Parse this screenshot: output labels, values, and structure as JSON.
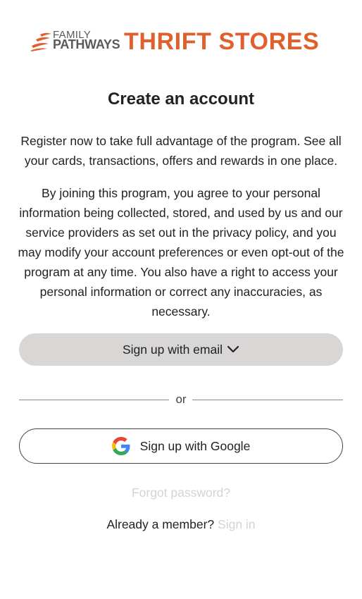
{
  "brand": {
    "family": "FAMILY",
    "pathways": "PATHWAYS",
    "stores": "THRIFT STORES",
    "accent_color": "#df5f2d"
  },
  "page": {
    "title": "Create an account",
    "intro": "Register now to take full advantage of the program. See all your cards, transactions, offers and rewards in one place.",
    "consent": "By joining this program, you agree to your personal information being collected, stored, and used by us and our service providers as set out in the privacy policy, and you may modify your account preferences or even opt-out of the program at any time. You also have a right to access your personal information or correct any inaccuracies, as necessary."
  },
  "actions": {
    "email_label": "Sign up with email",
    "email_icon": "chevron-down-icon",
    "divider_text": "or",
    "google_label": "Sign up with Google",
    "google_icon": "google-icon",
    "forgot_label": "Forgot password?",
    "member_text": "Already a member?",
    "signin_label": "Sign in"
  }
}
